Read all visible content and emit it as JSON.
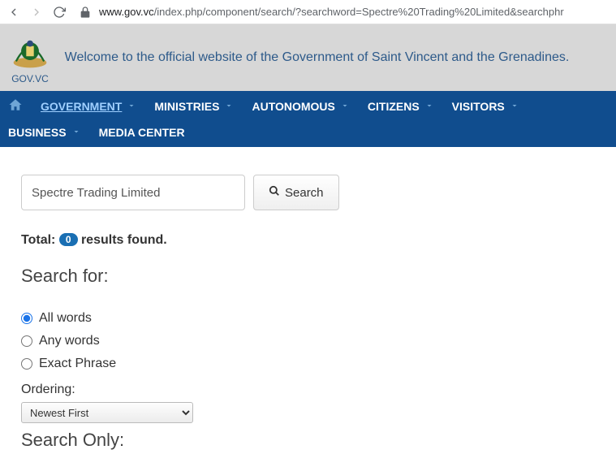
{
  "browser": {
    "url_domain": "www.gov.vc",
    "url_path": "/index.php/component/search/?searchword=Spectre%20Trading%20Limited&searchphr"
  },
  "header": {
    "site_label": "GOV.VC",
    "welcome": "Welcome to the official website of the Government of Saint Vincent and the Grenadines."
  },
  "nav": {
    "government": "GOVERNMENT",
    "ministries": "MINISTRIES",
    "autonomous": "AUTONOMOUS",
    "citizens": "CITIZENS",
    "visitors": "VISITORS",
    "business": "BUSINESS",
    "media_center": "MEDIA CENTER"
  },
  "search": {
    "input_value": "Spectre Trading Limited",
    "button_label": "Search"
  },
  "results": {
    "total_prefix": "Total:",
    "total_count": "0",
    "total_suffix": "results found."
  },
  "search_for": {
    "title": "Search for:",
    "all_words": "All words",
    "any_words": "Any words",
    "exact_phrase": "Exact Phrase"
  },
  "ordering": {
    "label": "Ordering:",
    "selected": "Newest First"
  },
  "search_only": {
    "title": "Search Only:"
  }
}
